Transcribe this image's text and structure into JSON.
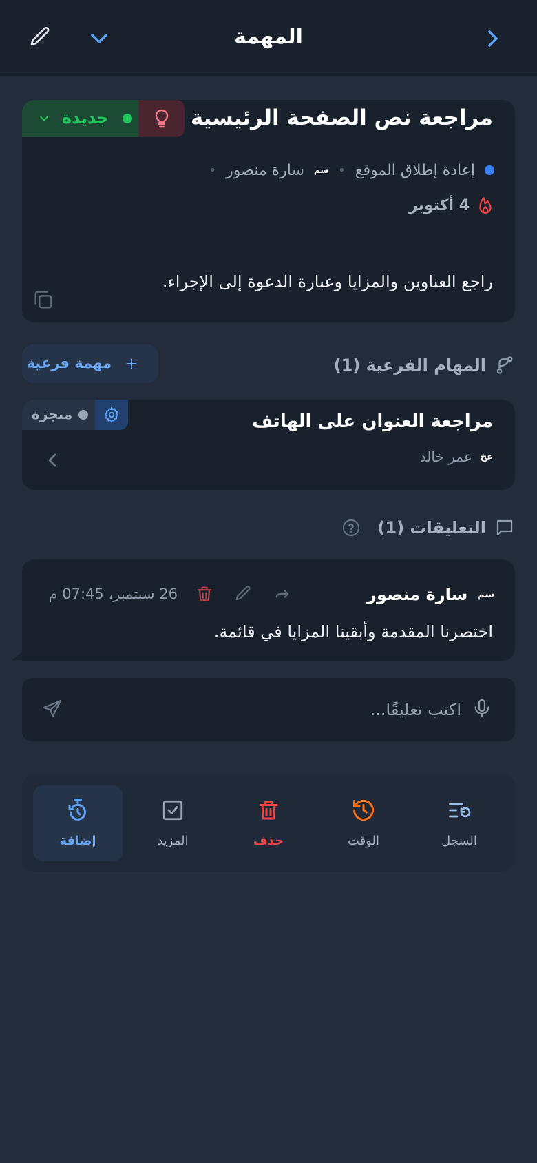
{
  "header": {
    "title": "المهمة",
    "back_icon": "chevron-right-icon",
    "collapse_icon": "chevron-down-icon",
    "edit_icon": "pencil-icon"
  },
  "task": {
    "title": "مراجعة نص الصفحة الرئيسية",
    "status": "جديدة",
    "project": "إعادة إطلاق الموقع",
    "assignee_initials": "سم",
    "assignee": "سارة منصور",
    "due_date": "4 أكتوبر",
    "description": "راجع العناوين والمزايا وعبارة الدعوة إلى الإجراء.",
    "colors": {
      "status": "#22c55e",
      "project_dot": "#3b82f6",
      "urgent": "#ef4444"
    }
  },
  "subtasks": {
    "heading": "المهام الفرعية (1)",
    "add_label": "مهمة فرعية",
    "items": [
      {
        "title": "مراجعة العنوان على الهاتف",
        "status": "منجزة",
        "assignee_initials": "عخ",
        "assignee": "عمر خالد"
      }
    ]
  },
  "comments": {
    "heading": "التعليقات (1)",
    "items": [
      {
        "author_initials": "سم",
        "author": "سارة منصور",
        "timestamp": "26 سبتمبر، 07:45 م",
        "body": "اختصرنا المقدمة وأبقينا المزايا في قائمة."
      }
    ],
    "input_placeholder": "اكتب تعليقًا..."
  },
  "bottom_nav": {
    "items": [
      {
        "label": "السجل",
        "icon": "history-list-icon"
      },
      {
        "label": "الوقت",
        "icon": "clock-history-icon"
      },
      {
        "label": "حذف",
        "icon": "trash-icon"
      },
      {
        "label": "المزيد",
        "icon": "checkbox-icon"
      },
      {
        "label": "إضافة",
        "icon": "timer-add-icon",
        "active": true
      }
    ]
  }
}
